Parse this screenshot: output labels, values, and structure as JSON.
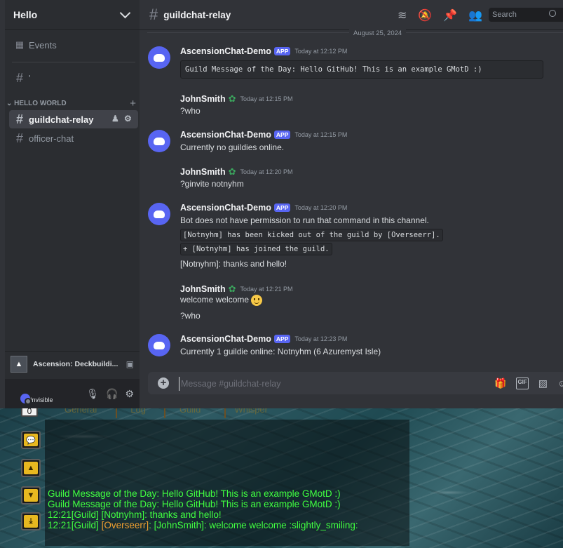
{
  "sidebar": {
    "server_name": "Hello",
    "events_label": "Events",
    "channel_top": "'",
    "category": "HELLO WORLD",
    "channels": [
      {
        "name": "guildchat-relay",
        "active": true
      },
      {
        "name": "officer-chat",
        "active": false
      }
    ],
    "activity": "Ascension: Deckbuildi...",
    "status": "Invisible"
  },
  "topbar": {
    "channel": "guildchat-relay",
    "search_placeholder": "Search"
  },
  "date_divider": "August 25, 2024",
  "messages": {
    "m1": {
      "author": "AscensionChat-Demo",
      "tag": "APP",
      "time": "Today at 12:12 PM",
      "code": "Guild Message of the Day: Hello GitHub!  This is an example GMotD :)"
    },
    "m2": {
      "author": "JohnSmith",
      "time": "Today at 12:15 PM",
      "text": "?who"
    },
    "m3": {
      "author": "AscensionChat-Demo",
      "tag": "APP",
      "time": "Today at 12:15 PM",
      "text": "Currently no guildies online."
    },
    "m4": {
      "author": "JohnSmith",
      "time": "Today at 12:20 PM",
      "text": "?ginvite notnyhm"
    },
    "m5": {
      "author": "AscensionChat-Demo",
      "tag": "APP",
      "time": "Today at 12:20 PM",
      "text": "Bot does not have permission to run that command in this channel.",
      "code1": "[Notnyhm] has been kicked out of the guild by [Overseerr].",
      "code2": "+ [Notnyhm] has joined the guild.",
      "text2": "[Notnyhm]: thanks and hello!"
    },
    "m6": {
      "author": "JohnSmith",
      "time": "Today at 12:21 PM",
      "text": "welcome welcome",
      "text2": "?who"
    },
    "m7": {
      "author": "AscensionChat-Demo",
      "tag": "APP",
      "time": "Today at 12:23 PM",
      "text": "Currently 1 guildie online: Notnyhm (6 Azuremyst Isle)"
    }
  },
  "composer": {
    "placeholder": "Message #guildchat-relay"
  },
  "game": {
    "counter": "0",
    "tabs": [
      "General",
      "Log",
      "Guild",
      "Whisper"
    ],
    "lines": [
      {
        "text": "Guild Message of the Day: Hello GitHub!  This is an example GMotD :)"
      },
      {
        "text": "Guild Message of the Day: Hello GitHub!  This is an example GMotD :)"
      },
      {
        "text": "12:21[Guild] [Notnyhm]: thanks and hello!"
      },
      {
        "prefix": "12:21[Guild] ",
        "name": "[Overseerr]",
        "suffix": ": [JohnSmith]: welcome welcome :slightly_smiling:"
      }
    ]
  }
}
